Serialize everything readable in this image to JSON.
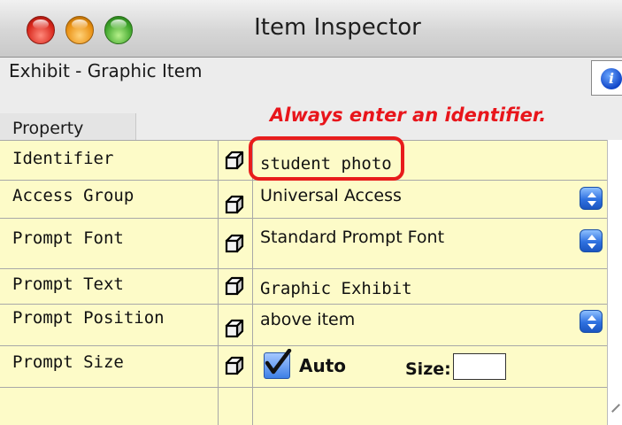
{
  "window": {
    "title": "Item Inspector"
  },
  "header": {
    "subtitle": "Exhibit - Graphic Item",
    "annotation": "Always enter an identifier.",
    "column_header": "Property"
  },
  "rows": [
    {
      "label": "Identifier",
      "value": "student photo",
      "has_popup": false
    },
    {
      "label": "Access Group",
      "value": "Universal Access",
      "has_popup": true
    },
    {
      "label": "Prompt Font",
      "value": "Standard Prompt Font",
      "has_popup": true
    },
    {
      "label": "Prompt Text",
      "value": "Graphic Exhibit",
      "has_popup": false
    },
    {
      "label": "Prompt Position",
      "value": "above item",
      "has_popup": true
    },
    {
      "label": "Prompt Size",
      "checkbox_label": "Auto",
      "checkbox_checked": true,
      "size_label": "Size:",
      "size_value": ""
    }
  ],
  "icons": [
    "info-icon",
    "cube-icon",
    "popup-arrows-icon",
    "checkmark-icon"
  ],
  "colors": {
    "table_bg": "#fdfbc8",
    "highlight": "#e81c1c",
    "annotation": "#e8151b",
    "accent_blue": "#2f71e0"
  }
}
